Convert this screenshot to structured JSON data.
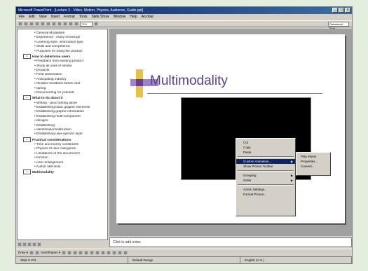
{
  "window": {
    "title": "Microsoft PowerPoint - [Lecture 3 - Video, Motion, Physics, Audience, Guide.ppt]",
    "min": "_",
    "max": "□",
    "close": "x"
  },
  "menu": [
    "File",
    "Edit",
    "View",
    "Insert",
    "Format",
    "Tools",
    "Slide Show",
    "Window",
    "Help",
    "Acrobat"
  ],
  "toolbar": {
    "zoom": "71%",
    "font": "Garamond Publ."
  },
  "outline": [
    {
      "level": 2,
      "text": "General Modalities"
    },
    {
      "level": 2,
      "text": "Experience - many meanings"
    },
    {
      "level": 2,
      "text": "Learning style, information type"
    },
    {
      "level": 2,
      "text": "Skills and competence"
    },
    {
      "level": 2,
      "text": "Purposes for using the product"
    },
    {
      "level": 1,
      "num": "2",
      "text": "How to determine users"
    },
    {
      "level": 2,
      "text": "Feedback from existing product"
    },
    {
      "level": 2,
      "text": "Study all uses of similar"
    },
    {
      "level": 2,
      "text": "products"
    },
    {
      "level": 2,
      "text": "Field observation"
    },
    {
      "level": 2,
      "text": "Anticipating industry"
    },
    {
      "level": 2,
      "text": "Iterative feedback before and"
    },
    {
      "level": 2,
      "text": "during"
    },
    {
      "level": 2,
      "text": "Documenting for yourself"
    },
    {
      "level": 1,
      "num": "3",
      "text": "What to do about it"
    },
    {
      "level": 2,
      "text": "Writing - good writing alone"
    },
    {
      "level": 2,
      "text": "Establishing basic graphic elements"
    },
    {
      "level": 2,
      "text": "Establishing graphic information"
    },
    {
      "level": 2,
      "text": "Establishing multi-component"
    },
    {
      "level": 2,
      "text": "designs"
    },
    {
      "level": 2,
      "text": "Establishing"
    },
    {
      "level": 2,
      "text": "identification/instruction"
    },
    {
      "level": 2,
      "text": "Establishing user-specific layer"
    },
    {
      "level": 1,
      "num": "4",
      "text": "Practical considerations"
    },
    {
      "level": 2,
      "text": "Time and money constraints"
    },
    {
      "level": 2,
      "text": "Physics of user categories"
    },
    {
      "level": 2,
      "text": "Limitations of the document's"
    },
    {
      "level": 2,
      "text": "function"
    },
    {
      "level": 2,
      "text": "User enlargement"
    },
    {
      "level": 2,
      "text": "Author skill level"
    },
    {
      "level": 1,
      "num": "5",
      "text": "Multimodality"
    }
  ],
  "slide": {
    "title": "Multimodality"
  },
  "context_menu": {
    "items": [
      "Cut",
      "Copy",
      "Paste",
      "Custom Animation...",
      "Show Picture Toolbar",
      "Grouping",
      "Order",
      "Action Settings...",
      "Format Picture..."
    ],
    "selected": "Custom Animation...",
    "submenu": [
      "Play Movie",
      "Properties...",
      "Convert..."
    ]
  },
  "notes": "Click to add notes",
  "drawbar": {
    "draw": "Draw ▾",
    "autoshapes": "AutoShapes ▾"
  },
  "status": [
    "Slide 5 of 5",
    "Default Design",
    "English (U.S.)"
  ]
}
